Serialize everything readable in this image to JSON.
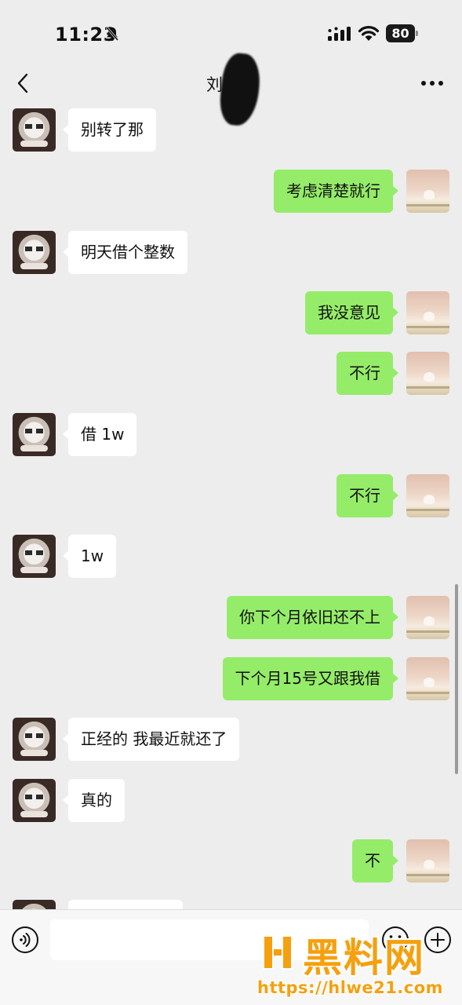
{
  "status_bar": {
    "time": "11:23",
    "battery": "80",
    "icons": [
      "bell-off-icon",
      "signal-icon",
      "wifi-icon",
      "battery-icon"
    ]
  },
  "header": {
    "title": "刘航汝",
    "back_icon": "chevron-left-icon",
    "more_icon": "ellipsis-icon"
  },
  "messages": [
    {
      "side": "left",
      "text": "别转了那"
    },
    {
      "side": "right",
      "text": "考虑清楚就行"
    },
    {
      "side": "left",
      "text": "明天借个整数"
    },
    {
      "side": "right",
      "text": "我没意见"
    },
    {
      "side": "right",
      "text": "不行"
    },
    {
      "side": "left",
      "text": "借 1w"
    },
    {
      "side": "right",
      "text": "不行"
    },
    {
      "side": "left",
      "text": "1w"
    },
    {
      "side": "right",
      "text": "你下个月依旧还不上"
    },
    {
      "side": "right",
      "text": "下个月15号又跟我借"
    },
    {
      "side": "left",
      "text": "正经的 我最近就还了"
    },
    {
      "side": "left",
      "text": "真的"
    },
    {
      "side": "right",
      "text": "不"
    },
    {
      "side": "left",
      "text": ""
    }
  ],
  "input_bar": {
    "icons": [
      "voice-icon",
      "emoji-icon",
      "plus-icon"
    ],
    "input_value": ""
  },
  "watermark": {
    "title": "黑料网",
    "url": "https://hlwe21.com"
  },
  "colors": {
    "background": "#ededed",
    "sent_bubble": "#95ec69",
    "received_bubble": "#ffffff",
    "watermark": "#f5a00f"
  }
}
